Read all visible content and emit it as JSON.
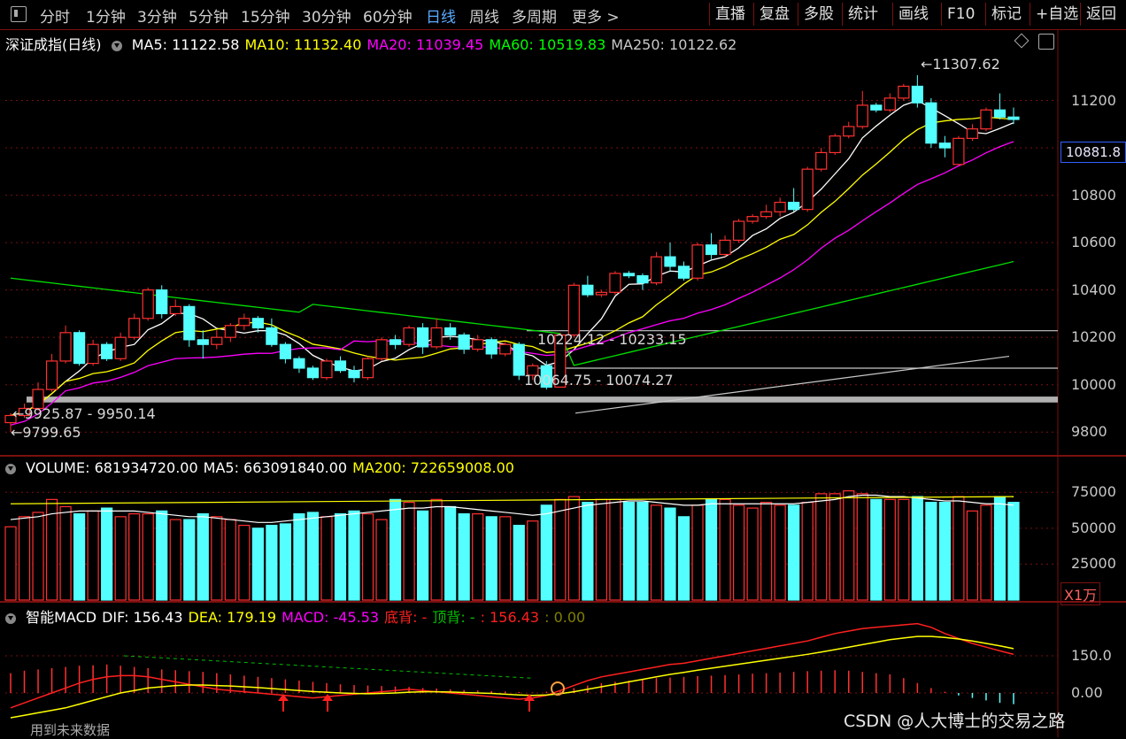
{
  "toolbar": {
    "periods": [
      "分时",
      "1分钟",
      "3分钟",
      "5分钟",
      "15分钟",
      "30分钟",
      "60分钟",
      "日线",
      "周线",
      "多周期",
      "更多 >"
    ],
    "active_period": "日线",
    "right_buttons": [
      "直播",
      "复盘",
      "多股",
      "统计",
      "画线",
      "F10",
      "标记",
      "+自选",
      "返回"
    ]
  },
  "main_chart": {
    "title": "深证成指(日线)",
    "ma": [
      {
        "label": "MA5: 11122.58",
        "color": "#ffffff"
      },
      {
        "label": "MA10: 11132.40",
        "color": "#ffff00"
      },
      {
        "label": "MA20: 11039.45",
        "color": "#ff00ff"
      },
      {
        "label": "MA60: 10519.83",
        "color": "#00ff00"
      },
      {
        "label": "MA250: 10122.62",
        "color": "#c8c8c8"
      }
    ],
    "y_ticks": [
      "11200",
      "11000",
      "10800",
      "10600",
      "10400",
      "10200",
      "10000",
      "9800"
    ],
    "current_price": "10881.8",
    "annotations": {
      "high": "11307.62",
      "low": "9799.65",
      "gap1": "9925.87 - 9950.14",
      "gap2": "10064.75 - 10074.27",
      "gap3": "10224.12 - 10233.15"
    }
  },
  "volume_chart": {
    "labels": [
      {
        "label": "VOLUME: 681934720.00",
        "color": "#ffffff"
      },
      {
        "label": "MA5: 663091840.00",
        "color": "#ffffff"
      },
      {
        "label": "MA200: 722659008.00",
        "color": "#ffff00"
      }
    ],
    "y_ticks": [
      "75000",
      "50000",
      "25000"
    ],
    "unit": "X1万"
  },
  "macd_chart": {
    "labels": [
      {
        "label": "智能MACD",
        "color": "#ffffff"
      },
      {
        "label": "DIF: 156.43",
        "color": "#ffffff"
      },
      {
        "label": "DEA: 179.19",
        "color": "#ffff00"
      },
      {
        "label": "MACD: -45.53",
        "color": "#ff00ff"
      },
      {
        "label": "底背: -",
        "color": "#ff2020"
      },
      {
        "label": "顶背: -",
        "color": "#00c000"
      },
      {
        "label": ": 156.43",
        "color": "#ff2020"
      },
      {
        "label": ": 0.00",
        "color": "#808000"
      }
    ],
    "y_ticks": [
      "150.0",
      "0.00"
    ],
    "footer": "用到未来数据"
  },
  "watermark": "CSDN @人大博士的交易之路",
  "colors": {
    "up": "#ff3030",
    "down": "#54ffff",
    "grid": "#7a1010"
  },
  "candles": [
    [
      9840,
      9870,
      9800,
      9880
    ],
    [
      9870,
      9900,
      9860,
      9920
    ],
    [
      9900,
      9980,
      9890,
      10010
    ],
    [
      9980,
      10100,
      9970,
      10130
    ],
    [
      10100,
      10220,
      10090,
      10250
    ],
    [
      10220,
      10090,
      10080,
      10230
    ],
    [
      10090,
      10170,
      10080,
      10190
    ],
    [
      10170,
      10110,
      10100,
      10180
    ],
    [
      10110,
      10200,
      10100,
      10220
    ],
    [
      10200,
      10280,
      10190,
      10300
    ],
    [
      10280,
      10400,
      10270,
      10410
    ],
    [
      10400,
      10300,
      10280,
      10420
    ],
    [
      10300,
      10330,
      10290,
      10360
    ],
    [
      10330,
      10190,
      10160,
      10340
    ],
    [
      10190,
      10170,
      10110,
      10230
    ],
    [
      10170,
      10200,
      10150,
      10230
    ],
    [
      10200,
      10250,
      10180,
      10260
    ],
    [
      10250,
      10280,
      10230,
      10300
    ],
    [
      10280,
      10240,
      10220,
      10290
    ],
    [
      10240,
      10170,
      10160,
      10280
    ],
    [
      10170,
      10110,
      10090,
      10180
    ],
    [
      10110,
      10070,
      10050,
      10120
    ],
    [
      10070,
      10030,
      10020,
      10080
    ],
    [
      10030,
      10100,
      10020,
      10110
    ],
    [
      10100,
      10060,
      10050,
      10120
    ],
    [
      10060,
      10030,
      10010,
      10080
    ],
    [
      10030,
      10110,
      10020,
      10120
    ],
    [
      10110,
      10190,
      10100,
      10200
    ],
    [
      10190,
      10170,
      10150,
      10210
    ],
    [
      10170,
      10240,
      10160,
      10250
    ],
    [
      10240,
      10160,
      10130,
      10260
    ],
    [
      10160,
      10240,
      10150,
      10280
    ],
    [
      10240,
      10210,
      10190,
      10260
    ],
    [
      10210,
      10150,
      10130,
      10220
    ],
    [
      10150,
      10190,
      10140,
      10210
    ],
    [
      10190,
      10130,
      10110,
      10200
    ],
    [
      10130,
      10170,
      10120,
      10180
    ],
    [
      10170,
      10040,
      10020,
      10180
    ],
    [
      10040,
      10080,
      10020,
      10090
    ],
    [
      10080,
      9990,
      9980,
      10100
    ],
    [
      9990,
      10210,
      9990,
      10220
    ],
    [
      10210,
      10420,
      10200,
      10430
    ],
    [
      10420,
      10380,
      10370,
      10460
    ],
    [
      10380,
      10390,
      10370,
      10400
    ],
    [
      10390,
      10470,
      10380,
      10480
    ],
    [
      10470,
      10460,
      10450,
      10480
    ],
    [
      10460,
      10430,
      10400,
      10470
    ],
    [
      10430,
      10540,
      10420,
      10560
    ],
    [
      10540,
      10500,
      10480,
      10600
    ],
    [
      10500,
      10450,
      10440,
      10520
    ],
    [
      10450,
      10590,
      10440,
      10600
    ],
    [
      10590,
      10550,
      10530,
      10640
    ],
    [
      10550,
      10610,
      10540,
      10630
    ],
    [
      10610,
      10690,
      10600,
      10700
    ],
    [
      10690,
      10710,
      10680,
      10720
    ],
    [
      10710,
      10730,
      10700,
      10760
    ],
    [
      10730,
      10770,
      10710,
      10790
    ],
    [
      10770,
      10740,
      10730,
      10830
    ],
    [
      10740,
      10910,
      10730,
      10920
    ],
    [
      10910,
      10980,
      10900,
      11000
    ],
    [
      10980,
      11050,
      10970,
      11060
    ],
    [
      11050,
      11090,
      11040,
      11110
    ],
    [
      11090,
      11180,
      11080,
      11240
    ],
    [
      11180,
      11160,
      11150,
      11190
    ],
    [
      11160,
      11210,
      11150,
      11230
    ],
    [
      11210,
      11260,
      11200,
      11270
    ],
    [
      11260,
      11190,
      11170,
      11307
    ],
    [
      11190,
      11020,
      11000,
      11210
    ],
    [
      11020,
      11000,
      10960,
      11050
    ],
    [
      10930,
      11040,
      10930,
      11050
    ],
    [
      11040,
      11080,
      11030,
      11100
    ],
    [
      11080,
      11160,
      11070,
      11170
    ],
    [
      11160,
      11130,
      11120,
      11230
    ],
    [
      11130,
      11120,
      11100,
      11170
    ]
  ],
  "volumes": [
    51,
    58,
    61,
    70,
    65,
    60,
    62,
    64,
    58,
    60,
    60,
    62,
    56,
    56,
    60,
    58,
    56,
    52,
    50,
    52,
    53,
    60,
    61,
    58,
    60,
    62,
    60,
    56,
    70,
    68,
    62,
    70,
    65,
    60,
    60,
    58,
    58,
    52,
    55,
    66,
    70,
    72,
    68,
    70,
    70,
    68,
    68,
    66,
    64,
    58,
    66,
    70,
    70,
    66,
    64,
    68,
    66,
    66,
    68,
    74,
    74,
    76,
    74,
    70,
    70,
    70,
    72,
    68,
    68,
    72,
    62,
    66,
    72,
    68
  ],
  "volume_ma": [
    56,
    57,
    58,
    60,
    61,
    62,
    62,
    62,
    62,
    62,
    61,
    60,
    59,
    58,
    58,
    57,
    56,
    55,
    54,
    54,
    55,
    56,
    57,
    58,
    59,
    60,
    61,
    62,
    63,
    64,
    64,
    65,
    65,
    64,
    63,
    62,
    61,
    60,
    59,
    60,
    62,
    64,
    66,
    67,
    68,
    69,
    69,
    68,
    67,
    66,
    66,
    67,
    67,
    67,
    67,
    67,
    67,
    67,
    68,
    69,
    70,
    72,
    73,
    73,
    72,
    72,
    71,
    70,
    69,
    69,
    68,
    67,
    67,
    66
  ],
  "macd_hist": [
    80,
    90,
    95,
    100,
    105,
    110,
    112,
    115,
    110,
    105,
    100,
    95,
    92,
    88,
    85,
    80,
    75,
    70,
    65,
    60,
    55,
    50,
    45,
    40,
    35,
    32,
    30,
    28,
    26,
    24,
    20,
    18,
    15,
    12,
    10,
    8,
    6,
    4,
    2,
    5,
    10,
    20,
    30,
    40,
    45,
    50,
    55,
    60,
    62,
    65,
    68,
    70,
    72,
    75,
    78,
    80,
    82,
    85,
    88,
    90,
    92,
    90,
    85,
    80,
    75,
    60,
    40,
    20,
    5,
    -10,
    -20,
    -30,
    -40,
    -45
  ],
  "dif": [
    -60,
    -40,
    -20,
    0,
    20,
    40,
    55,
    65,
    70,
    70,
    65,
    55,
    45,
    35,
    25,
    15,
    10,
    5,
    0,
    -5,
    -10,
    -15,
    -20,
    -15,
    -10,
    -5,
    0,
    5,
    10,
    15,
    10,
    5,
    0,
    -5,
    -10,
    -15,
    -20,
    -25,
    -20,
    -10,
    10,
    30,
    50,
    65,
    75,
    85,
    95,
    105,
    115,
    120,
    130,
    140,
    150,
    160,
    170,
    180,
    190,
    200,
    210,
    225,
    240,
    250,
    260,
    265,
    270,
    275,
    280,
    265,
    240,
    220,
    200,
    185,
    170,
    156
  ],
  "dea": [
    -100,
    -90,
    -80,
    -70,
    -60,
    -45,
    -30,
    -15,
    0,
    10,
    20,
    25,
    30,
    32,
    32,
    30,
    28,
    25,
    22,
    18,
    14,
    10,
    6,
    3,
    0,
    -2,
    -3,
    -2,
    0,
    3,
    5,
    5,
    4,
    2,
    0,
    -2,
    -5,
    -8,
    -10,
    -8,
    -3,
    5,
    15,
    25,
    35,
    45,
    55,
    65,
    75,
    83,
    92,
    100,
    108,
    116,
    124,
    132,
    140,
    148,
    156,
    165,
    175,
    185,
    195,
    205,
    215,
    222,
    228,
    228,
    224,
    218,
    210,
    200,
    190,
    179
  ]
}
